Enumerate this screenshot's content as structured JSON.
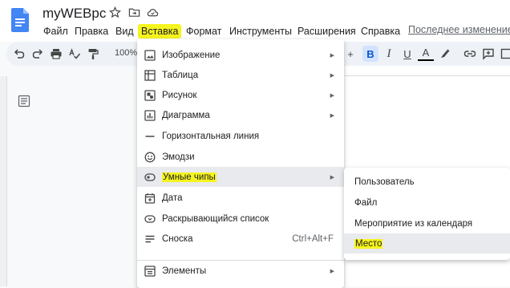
{
  "doc": {
    "title": "myWEBpc"
  },
  "menubar": {
    "items": [
      "Файл",
      "Правка",
      "Вид",
      "Вставка",
      "Формат",
      "Инструменты",
      "Расширения",
      "Справка"
    ],
    "active": "Вставка",
    "last_edit": "Последнее изменение:"
  },
  "toolbar": {
    "zoom": "100%",
    "bold": "B",
    "italic": "I",
    "underline": "U",
    "text_color": "A",
    "plus": "+"
  },
  "insert_menu": {
    "items": [
      {
        "label": "Изображение",
        "icon": "image-icon",
        "submenu": true
      },
      {
        "label": "Таблица",
        "icon": "table-icon",
        "submenu": true
      },
      {
        "label": "Рисунок",
        "icon": "drawing-icon",
        "submenu": true
      },
      {
        "label": "Диаграмма",
        "icon": "chart-icon",
        "submenu": true
      },
      {
        "label": "Горизонтальная линия",
        "icon": "horizontal-line-icon",
        "submenu": false
      },
      {
        "label": "Эмодзи",
        "icon": "emoji-icon",
        "submenu": false
      },
      {
        "label": "Умные чипы",
        "icon": "smart-chips-icon",
        "submenu": true
      },
      {
        "label": "Дата",
        "icon": "date-icon",
        "submenu": false
      },
      {
        "label": "Раскрывающийся список",
        "icon": "dropdown-icon",
        "submenu": false
      },
      {
        "label": "Сноска",
        "icon": "footnote-icon",
        "shortcut": "Ctrl+Alt+F",
        "submenu": false
      },
      {
        "label": "Элементы",
        "icon": "building-blocks-icon",
        "submenu": true
      }
    ],
    "highlighted": "Умные чипы"
  },
  "smart_chips_submenu": {
    "items": [
      "Пользователь",
      "Файл",
      "Мероприятие из календаря",
      "Место"
    ],
    "highlighted": "Место"
  },
  "colors": {
    "highlight": "#f6f41f",
    "hover": "#e8eaed",
    "doc_blue": "#4285f4"
  }
}
